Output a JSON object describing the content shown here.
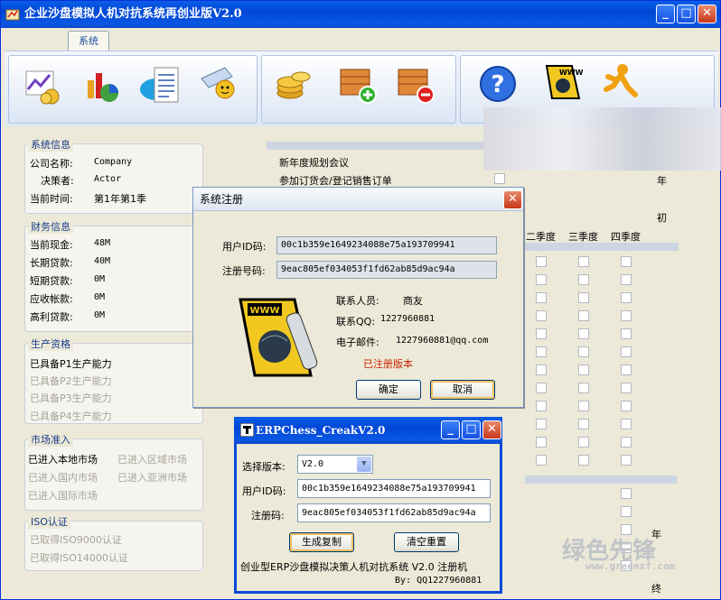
{
  "window": {
    "title": "企业沙盘模拟人机对抗系统再创业版V2.0",
    "tab": "系统"
  },
  "ribbon": {
    "icons": [
      "chart-money-icon",
      "bar-chart-icon",
      "pie-chart-icon",
      "document-icon",
      "settings-sun-icon",
      "coins-icon",
      "box-add-icon",
      "box-remove-icon",
      "help-icon",
      "www-phone-icon",
      "runner-icon"
    ]
  },
  "sys_info": {
    "title": "系统信息",
    "rows": [
      {
        "label": "公司名称:",
        "value": "Company"
      },
      {
        "label": "决策者:",
        "value": "Actor"
      },
      {
        "label": "当前时间:",
        "value": "第1年第1季"
      }
    ]
  },
  "finance": {
    "title": "财务信息",
    "rows": [
      {
        "label": "当前现金:",
        "value": "48M"
      },
      {
        "label": "长期贷款:",
        "value": "40M"
      },
      {
        "label": "短期贷款:",
        "value": "0M"
      },
      {
        "label": "应收帐款:",
        "value": "0M"
      },
      {
        "label": "高利贷款:",
        "value": "0M"
      }
    ]
  },
  "production": {
    "title": "生产资格",
    "items": [
      "已具备P1生产能力",
      "已具备P2生产能力",
      "已具备P3生产能力",
      "已具备P4生产能力"
    ]
  },
  "market": {
    "title": "市场准入",
    "items": [
      "已进入本地市场",
      "已进入区域市场",
      "已进入国内市场",
      "已进入亚洲市场",
      "已进入国际市场"
    ]
  },
  "iso": {
    "title": "ISO认证",
    "items": [
      "已取得ISO9000认证",
      "已取得ISO14000认证"
    ]
  },
  "plan": {
    "line1": "新年度规划会议",
    "line2": "参加订货会/登记销售订单",
    "year": "年",
    "begin": "初",
    "quarters": [
      "二季度",
      "三季度",
      "四季度"
    ],
    "year2": "年",
    "end": "终"
  },
  "register_dialog": {
    "title": "系统注册",
    "user_id_label": "用户ID码:",
    "user_id": "00c1b359e1649234088e75a193709941",
    "reg_label": "注册号码:",
    "reg_code": "9eac805ef034053f1fd62ab85d9ac94a",
    "contact_label": "联系人员:",
    "contact": "商友",
    "qq_label": "联系QQ:",
    "qq": "1227960881",
    "email_label": "电子邮件:",
    "email": "1227960881@qq.com",
    "status": "已注册版本",
    "ok": "确定",
    "cancel": "取消"
  },
  "crack": {
    "title": "ERPChess_CreakV2.0",
    "version_label": "选择版本:",
    "version": "V2.0",
    "user_id_label": "用户ID码:",
    "user_id": "00c1b359e1649234088e75a193709941",
    "reg_label": "注册码:",
    "reg_code": "9eac805ef034053f1fd62ab85d9ac94a",
    "generate": "生成复制",
    "clear": "清空重置",
    "footer": "创业型ERP沙盘模拟决策人机对抗系统 V2.0 注册机",
    "by": "By: QQ1227960881"
  },
  "watermark": {
    "text": "绿色先锋",
    "url": "www.greenxf.com"
  },
  "colors": {
    "title_blue": "#0046d5",
    "panel_title": "#1a3c8c",
    "status_red": "#cc2200"
  }
}
